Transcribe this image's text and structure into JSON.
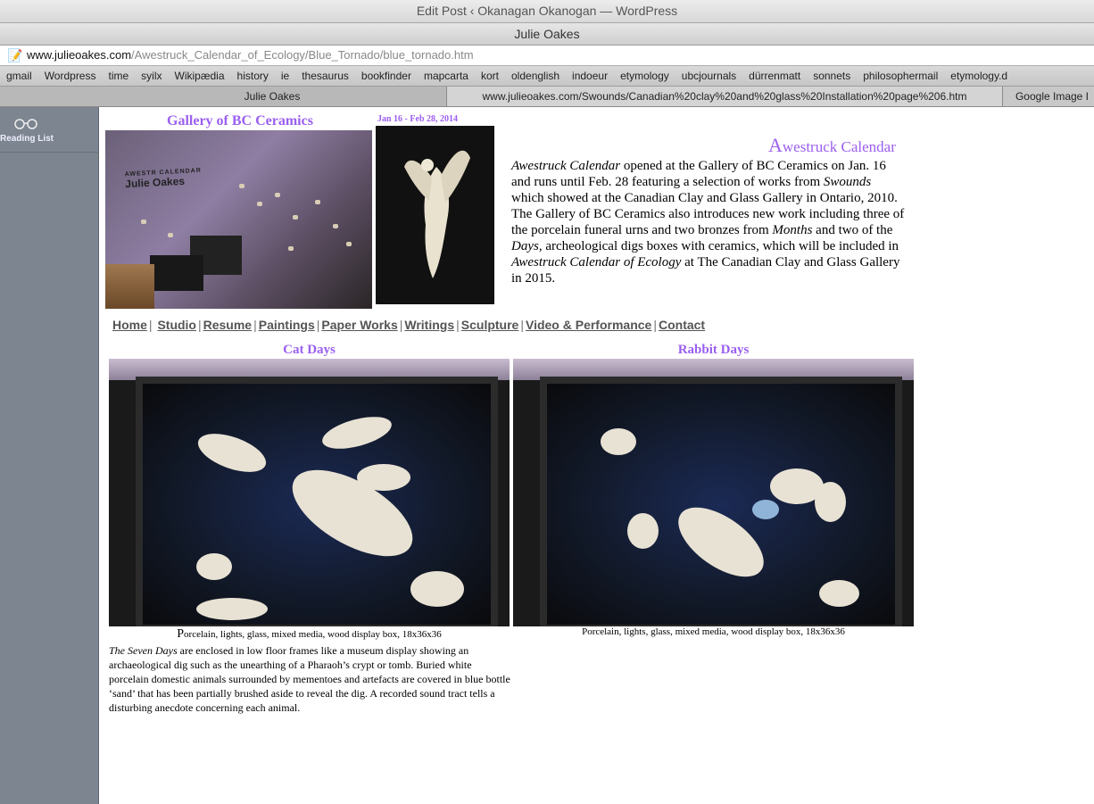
{
  "browser": {
    "window_title": "Edit Post ‹ Okanagan Okanogan — WordPress",
    "page_title": "Julie Oakes",
    "url_domain": "www.julieoakes.com",
    "url_path": "/Awestruck_Calendar_of_Ecology/Blue_Tornado/blue_tornado.htm",
    "bookmarks": [
      "gmail",
      "Wordpress",
      "time",
      "syilx",
      "Wikipædia",
      "history",
      "ie",
      "thesaurus",
      "bookfinder",
      "mapcarta",
      "kort",
      "oldenglish",
      "indoeur",
      "etymology",
      "ubcjournals",
      "dürrenmatt",
      "sonnets",
      "philosophermail",
      "etymology.d"
    ],
    "tabs": [
      "Julie Oakes",
      "www.julieoakes.com/Swounds/Canadian%20clay%20and%20glass%20Installation%20page%206.htm",
      "Google Image I"
    ]
  },
  "sidebar": {
    "reading_list_label": "Reading List"
  },
  "page": {
    "gallery_title": "Gallery of BC Ceramics",
    "date_label": "Jan 16 - Feb 28, 2014",
    "photo_sign_small": "AWESTR  CALENDAR",
    "photo_sign": "Julie Oakes",
    "awestruck_cap": "A",
    "awestruck_rest": "westruck Calendar",
    "intro_em1": "Awestruck Calendar",
    "intro_t1": " opened at the Gallery of BC Ceramics on Jan. 16 and runs until Feb. 28 featuring a selection of works from ",
    "intro_em2": "Swounds",
    "intro_t2": " which showed at the Canadian Clay and Glass Gallery in Ontario, 2010. The Gallery of BC Ceramics also introduces new work including three of the porcelain funeral urns and two bronzes from ",
    "intro_em3": "Months",
    "intro_t3": " and two of the ",
    "intro_em4": "Days,",
    "intro_t4": " archeological digs boxes with ceramics, which will be included in ",
    "intro_em5": "Awestruck Calendar of Ecology",
    "intro_t5": " at The Canadian Clay and Glass Gallery in 2015.",
    "nav": [
      "Home",
      "Studio",
      "Resume",
      "Paintings",
      "Paper Works",
      "Writings",
      "Sculpture",
      "Video & Performance",
      "Contact"
    ],
    "cat_title": "Cat Days",
    "rabbit_title": "Rabbit Days",
    "cat_caption_cap": "P",
    "cat_caption_rest": "orcelain, lights, glass, mixed media, wood display box, 18x36x36",
    "rabbit_caption": "Porcelain, lights, glass, mixed media, wood display box, 18x36x36",
    "desc_em": "The Seven Days",
    "desc_text": " are enclosed in low floor frames like a museum display showing an archaeological dig such as the unearthing of a Pharaoh’s crypt or tomb. Buried white porcelain domestic animals surrounded by mementoes and artefacts are covered in blue bottle ‘sand’ that has been partially brushed aside to reveal the dig. A recorded sound tract tells a disturbing anecdote concerning each animal."
  },
  "colors": {
    "accent_purple": "#9b5ff0",
    "sidebar": "#7d8590"
  }
}
